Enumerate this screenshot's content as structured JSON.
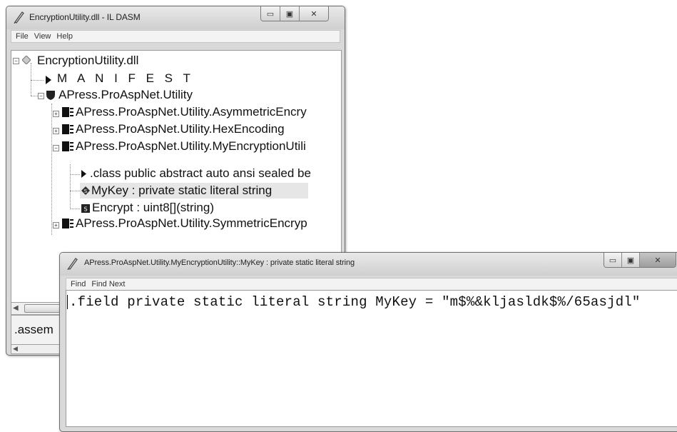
{
  "ildasm": {
    "title": "EncryptionUtility.dll - IL DASM",
    "menu": [
      "File",
      "View",
      "Help"
    ],
    "tree": {
      "root": "EncryptionUtility.dll",
      "manifest": "M A N I F E S T",
      "namespace": "APress.ProAspNet.Utility",
      "class_asym": "APress.ProAspNet.Utility.AsymmetricEncry",
      "class_hex": "APress.ProAspNet.Utility.HexEncoding",
      "class_my": "APress.ProAspNet.Utility.MyEncryptionUtili",
      "class_decl": ".class public abstract auto ansi sealed be",
      "field_mykey": "MyKey : private static literal string",
      "method_encrypt": "Encrypt : uint8[](string)",
      "class_sym": "APress.ProAspNet.Utility.SymmetricEncryp"
    },
    "info_text": ".assem"
  },
  "disasm": {
    "title": "APress.ProAspNet.Utility.MyEncryptionUtility::MyKey : private static literal string",
    "menu": [
      "Find",
      "Find Next"
    ],
    "code": ".field private static literal string MyKey = \"m$%&kljasldk$%/65asjdl\""
  },
  "icons": {
    "pen": "pen-icon",
    "minimize": "minimize-icon",
    "maximize": "maximize-icon",
    "close": "close-icon",
    "assembly": "assembly-diamond-icon",
    "manifest": "triangle-right-icon",
    "namespace": "namespace-shield-icon",
    "class": "class-icon",
    "field": "static-field-icon",
    "method": "static-method-icon"
  }
}
